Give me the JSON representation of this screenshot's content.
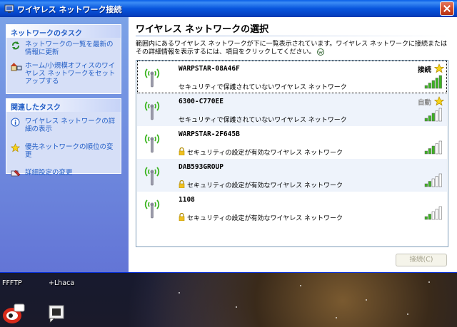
{
  "window": {
    "title": "ワイヤレス ネットワーク接続"
  },
  "network_tasks": {
    "header": "ネットワークのタスク",
    "items": [
      {
        "label": "ネットワークの一覧を最新の情報に更新",
        "icon": "refresh-icon"
      },
      {
        "label": "ホーム/小規模オフィスのワイヤレス ネットワークをセットアップする",
        "icon": "home-network-icon"
      }
    ]
  },
  "related_tasks": {
    "header": "関連したタスク",
    "items": [
      {
        "label": "ワイヤレス ネットワークの詳細の表示",
        "icon": "info-icon"
      },
      {
        "label": "優先ネットワークの順位の変更",
        "icon": "star-icon"
      },
      {
        "label": "詳細設定の変更",
        "icon": "settings-icon"
      }
    ]
  },
  "main": {
    "title": "ワイヤレス ネットワークの選択",
    "description": "範囲内にあるワイヤレス ネットワークが下に一覧表示されています。ワイヤレス ネットワークに接続またはその詳細情報を表示するには、項目をクリックしてください。",
    "networks": [
      {
        "name": "WARPSTAR-08A46F",
        "security": "セキュリティで保護されていないワイヤレス ネットワーク",
        "status": "接続",
        "favorite": true,
        "signal": 5,
        "locked": false
      },
      {
        "name": "6300-C770EE",
        "security": "セキュリティで保護されていないワイヤレス ネットワーク",
        "status": "自動",
        "favorite": true,
        "signal": 3,
        "locked": false
      },
      {
        "name": "WARPSTAR-2F645B",
        "security": "セキュリティの設定が有効なワイヤレス ネットワーク",
        "status": "",
        "favorite": false,
        "signal": 3,
        "locked": true
      },
      {
        "name": "DAB593GROUP",
        "security": "セキュリティの設定が有効なワイヤレス ネットワーク",
        "status": "",
        "favorite": false,
        "signal": 2,
        "locked": true
      },
      {
        "name": "1108",
        "security": "セキュリティの設定が有効なワイヤレス ネットワーク",
        "status": "",
        "favorite": false,
        "signal": 2,
        "locked": true
      }
    ],
    "connect_label": "接続(C)"
  },
  "desktop": {
    "icons": [
      {
        "label": "FFFTP"
      },
      {
        "label": "+Lhaca"
      }
    ]
  },
  "colors": {
    "titlebar": "#0855dd",
    "link": "#215dc6",
    "signal_green": "#3cb521",
    "signal_empty": "#ffffff",
    "star": "#f7d41a"
  }
}
